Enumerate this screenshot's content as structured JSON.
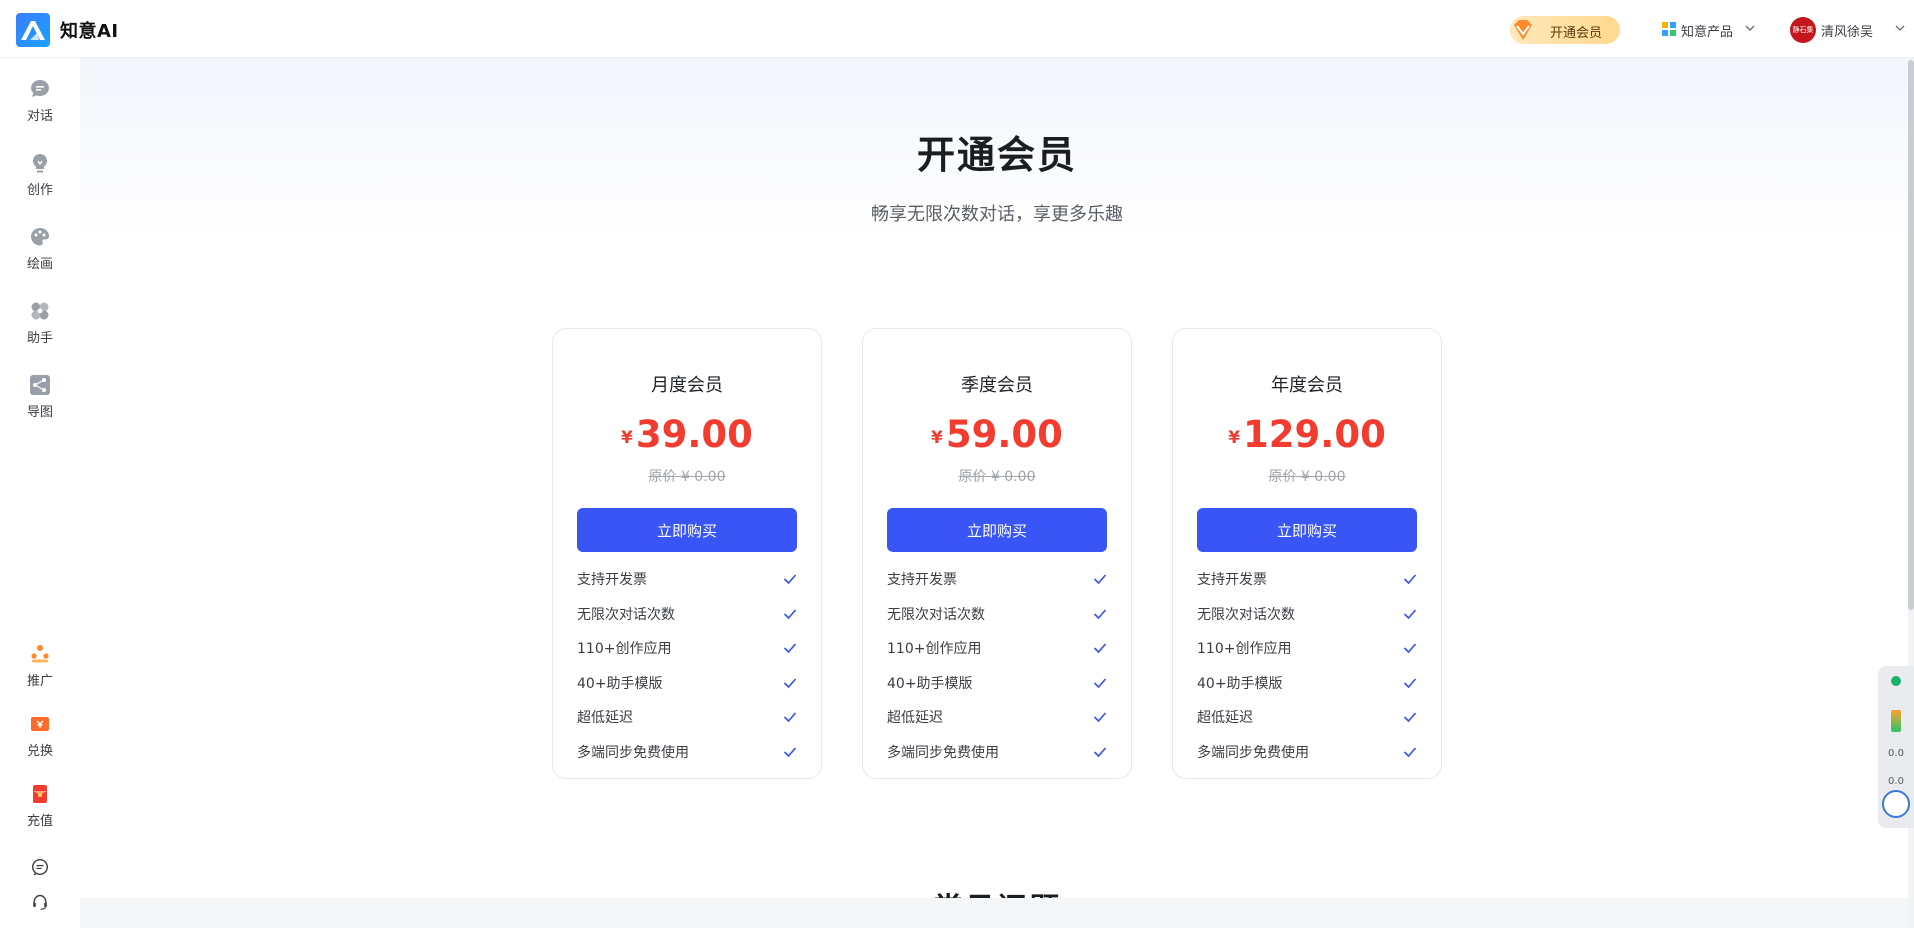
{
  "header": {
    "brand": "知意AI",
    "vip_label": "开通会员",
    "products_label": "知意产品",
    "user_name": "清风徐吴",
    "avatar_text": "静石集"
  },
  "sidebar": {
    "top_items": [
      {
        "label": "对话",
        "icon": "chat-bubble-icon"
      },
      {
        "label": "创作",
        "icon": "lightbulb-icon"
      },
      {
        "label": "绘画",
        "icon": "palette-icon"
      },
      {
        "label": "助手",
        "icon": "assistant-icon"
      },
      {
        "label": "导图",
        "icon": "mindmap-icon"
      }
    ],
    "bottom_items": [
      {
        "label": "推广",
        "icon": "promote-icon"
      },
      {
        "label": "兑换",
        "icon": "redeem-icon"
      },
      {
        "label": "充值",
        "icon": "recharge-icon"
      }
    ],
    "footer_icons": [
      "message-icon",
      "headset-icon"
    ]
  },
  "main": {
    "title": "开通会员",
    "subtitle": "畅享无限次数对话，享更多乐趣",
    "plans": [
      {
        "name": "月度会员",
        "currency": "¥",
        "price": "39.00",
        "original": "原价 ¥ 0.00",
        "button": "立即购买"
      },
      {
        "name": "季度会员",
        "currency": "¥",
        "price": "59.00",
        "original": "原价 ¥ 0.00",
        "button": "立即购买"
      },
      {
        "name": "年度会员",
        "currency": "¥",
        "price": "129.00",
        "original": "原价 ¥ 0.00",
        "button": "立即购买"
      }
    ],
    "features": [
      "支持开发票",
      "无限次对话次数",
      "110+创作应用",
      "40+助手模版",
      "超低延迟",
      "多端同步免费使用"
    ],
    "faq_title": "常见问题"
  },
  "widget": {
    "value1": "0.0",
    "value2": "0.0"
  },
  "colors": {
    "accent": "#3a55f5",
    "price": "#f23c2f",
    "vip_gold": "#ffd98f"
  }
}
